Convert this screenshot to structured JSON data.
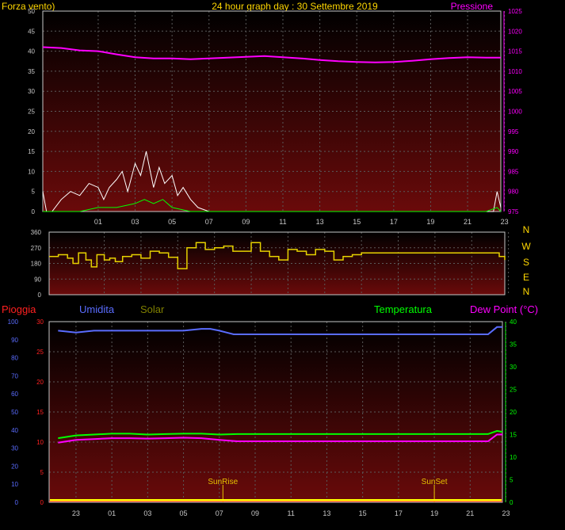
{
  "header": {
    "left_label": "Forza vento)",
    "title": "24 hour graph day : 30 Settembre 2019",
    "right_label": "Pressione"
  },
  "colors": {
    "background": "#000000",
    "panel_top": "#000000",
    "panel_bottom": "#6a0a0a",
    "grid": "#5a5a5a",
    "axis": "#c8c8c8",
    "title": "#ffd700",
    "pressure": "#ff00ff",
    "wind_gust": "#ffffff",
    "wind_avg": "#c0c0c0",
    "wind_green": "#00ff00",
    "direction": "#e6d200",
    "rain": "#ff2020",
    "humidity": "#5a6cff",
    "solar": "#808000",
    "temperature": "#00ff00",
    "dewpoint": "#ff00ff",
    "sun_marker": "#e6c200",
    "rain_bar": "#ffff00"
  },
  "chart_data": [
    {
      "type": "line",
      "name": "wind-pressure",
      "x_ticks": [
        "01",
        "03",
        "05",
        "07",
        "09",
        "11",
        "13",
        "15",
        "17",
        "19",
        "21",
        "23"
      ],
      "y_left": [
        0,
        5,
        10,
        15,
        20,
        25,
        30,
        35,
        40,
        45,
        50
      ],
      "y_right": [
        975,
        980,
        985,
        990,
        995,
        1000,
        1005,
        1010,
        1015,
        1020,
        1025
      ],
      "ylim_left": [
        0,
        50
      ],
      "ylim_right": [
        975,
        1025
      ],
      "xlim_hours": [
        22,
        24.8
      ],
      "series": [
        {
          "key": "pressure",
          "axis": "right",
          "x": [
            22,
            23,
            24,
            25,
            26,
            27,
            28,
            29,
            30,
            31,
            32,
            33,
            34,
            35,
            36,
            37,
            38,
            39,
            40,
            41,
            42,
            43,
            44,
            45,
            46,
            46.8
          ],
          "values": [
            1016,
            1015.8,
            1015.2,
            1015,
            1014.2,
            1013.5,
            1013.2,
            1013.2,
            1013,
            1013.2,
            1013.4,
            1013.6,
            1013.8,
            1013.5,
            1013.2,
            1012.8,
            1012.5,
            1012.3,
            1012.2,
            1012.3,
            1012.6,
            1013,
            1013.3,
            1013.5,
            1013.4,
            1013.4
          ]
        },
        {
          "key": "wind_gust",
          "axis": "left",
          "x": [
            22,
            22.2,
            22.5,
            23,
            23.5,
            24,
            24.5,
            25,
            25.3,
            25.6,
            26,
            26.3,
            26.6,
            27,
            27.3,
            27.6,
            28,
            28.3,
            28.6,
            29,
            29.3,
            29.6,
            30,
            30.4,
            31,
            46.4,
            46.6,
            46.8
          ],
          "values": [
            5,
            0,
            0,
            3,
            5,
            4,
            7,
            6,
            3,
            6,
            8,
            10,
            5,
            12,
            9,
            15,
            6,
            11,
            7,
            9,
            4,
            6,
            3,
            1,
            0,
            0,
            5,
            1
          ]
        },
        {
          "key": "wind_green",
          "axis": "left",
          "x": [
            22,
            23,
            24,
            25,
            26,
            27,
            27.5,
            28,
            28.5,
            29,
            30,
            46,
            46.6,
            46.8
          ],
          "values": [
            0,
            0,
            0,
            1,
            1,
            2,
            3,
            2,
            3,
            1,
            0,
            0,
            1,
            0
          ]
        }
      ]
    },
    {
      "type": "line",
      "name": "wind-direction",
      "y_ticks": [
        0,
        90,
        180,
        270,
        360
      ],
      "y_labels": [
        "0",
        "90",
        "180",
        "270",
        "360"
      ],
      "compass": [
        "N",
        "W",
        "S",
        "E",
        "N"
      ],
      "ylim": [
        0,
        360
      ],
      "series": [
        {
          "key": "direction",
          "x": [
            22,
            22.5,
            23,
            23.3,
            23.6,
            24,
            24.3,
            24.6,
            25,
            25.3,
            25.6,
            26,
            26.5,
            27,
            27.5,
            28,
            28.5,
            29,
            29.5,
            30,
            30.5,
            31,
            31.5,
            32,
            32.5,
            33,
            33.5,
            34,
            34.5,
            35,
            35.5,
            36,
            36.5,
            37,
            37.5,
            38,
            38.5,
            39,
            40,
            41,
            42,
            43,
            44,
            45,
            46,
            46.5,
            46.8
          ],
          "values": [
            220,
            230,
            210,
            180,
            240,
            200,
            160,
            230,
            200,
            210,
            190,
            220,
            230,
            210,
            250,
            240,
            215,
            150,
            270,
            300,
            260,
            270,
            280,
            250,
            250,
            300,
            250,
            220,
            200,
            260,
            250,
            230,
            260,
            250,
            200,
            220,
            230,
            240,
            240,
            240,
            240,
            240,
            240,
            240,
            240,
            220,
            200
          ]
        }
      ]
    },
    {
      "type": "line",
      "name": "rain-humidity-temp",
      "legend": [
        "Pioggia",
        "Umidita",
        "Solar",
        "Temperatura",
        "Dew Point (°C)"
      ],
      "x_ticks": [
        "23",
        "01",
        "03",
        "05",
        "07",
        "09",
        "11",
        "13",
        "15",
        "17",
        "19",
        "21",
        "23"
      ],
      "y_rain": [
        0,
        5,
        10,
        15,
        20,
        25,
        30
      ],
      "y_humidity": [
        0,
        10,
        20,
        30,
        40,
        50,
        60,
        70,
        80,
        90,
        100
      ],
      "y_temp": [
        0,
        5,
        10,
        15,
        20,
        25,
        30,
        35,
        40
      ],
      "ylim_humidity": [
        0,
        100
      ],
      "ylim_temp": [
        0,
        40
      ],
      "annotations": [
        {
          "label": "SunRise",
          "hour": 31.2
        },
        {
          "label": "SunSet",
          "hour": 43.0
        }
      ],
      "series": [
        {
          "key": "humidity",
          "axis": "humidity",
          "x": [
            22,
            23,
            24,
            25,
            26,
            27,
            28,
            29,
            30,
            30.5,
            31,
            31.4,
            31.8,
            32,
            33,
            34,
            35,
            36,
            37,
            38,
            39,
            40,
            41,
            42,
            43,
            44,
            45,
            46,
            46.5,
            46.8
          ],
          "values": [
            95,
            94,
            95,
            95,
            95,
            95,
            95,
            95,
            96,
            96,
            95,
            94,
            93,
            93,
            93,
            93,
            93,
            93,
            93,
            93,
            93,
            93,
            93,
            93,
            93,
            93,
            93,
            93,
            97,
            97
          ]
        },
        {
          "key": "temperature",
          "axis": "temp",
          "x": [
            22,
            23,
            24,
            25,
            26,
            27,
            28,
            29,
            30,
            31,
            32,
            33,
            34,
            35,
            36,
            37,
            38,
            39,
            40,
            41,
            42,
            43,
            44,
            45,
            46,
            46.5,
            46.8
          ],
          "values": [
            14.2,
            14.8,
            15.0,
            15.2,
            15.2,
            15.0,
            15.1,
            15.2,
            15.2,
            15.0,
            15.1,
            15.1,
            15.1,
            15.1,
            15.1,
            15.1,
            15.1,
            15.1,
            15.1,
            15.1,
            15.1,
            15.1,
            15.1,
            15.1,
            15.1,
            15.8,
            15.6
          ]
        },
        {
          "key": "dewpoint",
          "axis": "temp",
          "x": [
            22,
            23,
            24,
            25,
            26,
            27,
            28,
            29,
            30,
            31,
            32,
            33,
            34,
            35,
            36,
            37,
            38,
            39,
            40,
            41,
            42,
            43,
            44,
            45,
            46,
            46.5,
            46.8
          ],
          "values": [
            13.2,
            13.8,
            14.0,
            14.2,
            14.2,
            14.1,
            14.2,
            14.3,
            14.2,
            13.8,
            13.5,
            13.5,
            13.5,
            13.5,
            13.5,
            13.5,
            13.5,
            13.5,
            13.5,
            13.5,
            13.5,
            13.5,
            13.5,
            13.5,
            13.5,
            15.0,
            15.0
          ]
        }
      ]
    }
  ]
}
